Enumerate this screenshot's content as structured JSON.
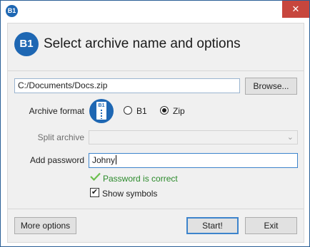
{
  "window": {
    "app_icon_text": "B1",
    "close_glyph": "✕"
  },
  "header": {
    "logo_text": "B1",
    "title": "Select archive name and options"
  },
  "path": {
    "value": "C:/Documents/Docs.zip",
    "browse_label": "Browse..."
  },
  "format": {
    "label": "Archive format",
    "icon_text": "B1",
    "options": [
      {
        "label": "B1",
        "checked": false
      },
      {
        "label": "Zip",
        "checked": true
      }
    ]
  },
  "split": {
    "label": "Split archive",
    "value": "",
    "chevron": "⌄"
  },
  "password": {
    "label": "Add password",
    "value": "Johny",
    "status_text": "Password is correct",
    "show_symbols_label": "Show symbols",
    "show_symbols_checked": true,
    "check_glyph": "✔"
  },
  "footer": {
    "more_options_label": "More options",
    "start_label": "Start!",
    "exit_label": "Exit"
  },
  "colors": {
    "accent": "#1e67b3",
    "close": "#c7463d",
    "success": "#2b8a2b"
  }
}
